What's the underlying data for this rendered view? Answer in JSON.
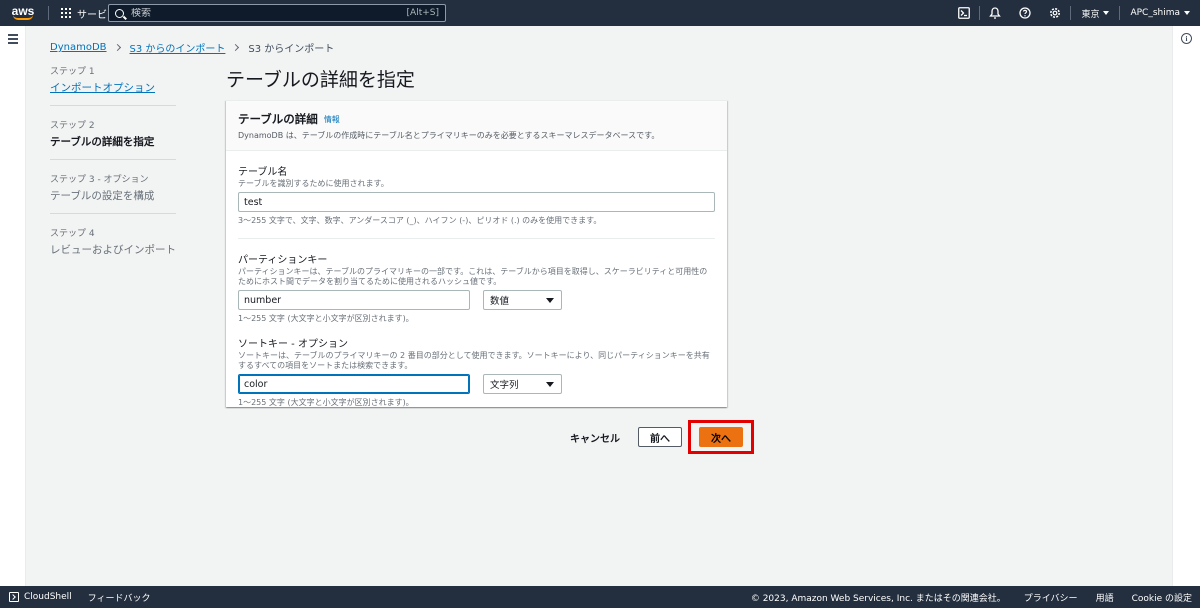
{
  "topnav": {
    "logo": "aws",
    "services_label": "サービス",
    "search_placeholder": "検索",
    "search_shortcut": "[Alt+S]",
    "region": "東京",
    "account": "APC_shima",
    "icons": [
      "cloudshell-icon",
      "bell-icon",
      "help-icon",
      "gear-icon"
    ]
  },
  "breadcrumb": {
    "items": [
      "DynamoDB",
      "S3 からのインポート",
      "S3 からインポート"
    ]
  },
  "steps": [
    {
      "num": "ステップ 1",
      "name": "インポートオプション",
      "state": "link"
    },
    {
      "num": "ステップ 2",
      "name": "テーブルの詳細を指定",
      "state": "active"
    },
    {
      "num": "ステップ 3 - オプション",
      "name": "テーブルの設定を構成",
      "state": "disabled"
    },
    {
      "num": "ステップ 4",
      "name": "レビューおよびインポート",
      "state": "disabled"
    }
  ],
  "page": {
    "title": "テーブルの詳細を指定"
  },
  "panel": {
    "title": "テーブルの詳細",
    "info": "情報",
    "description": "DynamoDB は、テーブルの作成時にテーブル名とプライマリキーのみを必要とするスキーマレスデータベースです。",
    "table_name": {
      "label": "テーブル名",
      "description": "テーブルを識別するために使用されます。",
      "value": "test",
      "constraint": "3～255 文字で、文字、数字、アンダースコア (_)、ハイフン (-)、ピリオド (.) のみを使用できます。"
    },
    "partition_key": {
      "label": "パーティションキー",
      "description": "パーティションキーは、テーブルのプライマリキーの一部です。これは、テーブルから項目を取得し、スケーラビリティと可用性のためにホスト間でデータを割り当てるために使用されるハッシュ値です。",
      "value": "number",
      "type": "数値",
      "constraint": "1～255 文字 (大文字と小文字が区別されます)。"
    },
    "sort_key": {
      "label": "ソートキー - オプション",
      "description": "ソートキーは、テーブルのプライマリキーの 2 番目の部分として使用できます。ソートキーにより、同じパーティションキーを共有するすべての項目をソートまたは検索できます。",
      "value": "color",
      "type": "文字列",
      "constraint": "1～255 文字 (大文字と小文字が区別されます)。"
    }
  },
  "actions": {
    "cancel": "キャンセル",
    "previous": "前へ",
    "next": "次へ"
  },
  "footer": {
    "cloudshell": "CloudShell",
    "feedback": "フィードバック",
    "copyright": "© 2023, Amazon Web Services, Inc. またはその関連会社。",
    "privacy": "プライバシー",
    "terms": "用語",
    "cookie": "Cookie の設定"
  },
  "colors": {
    "nav_bg": "#232f3e",
    "link": "#0073bb",
    "primary": "#ec7211",
    "highlight_box": "#e30000"
  }
}
